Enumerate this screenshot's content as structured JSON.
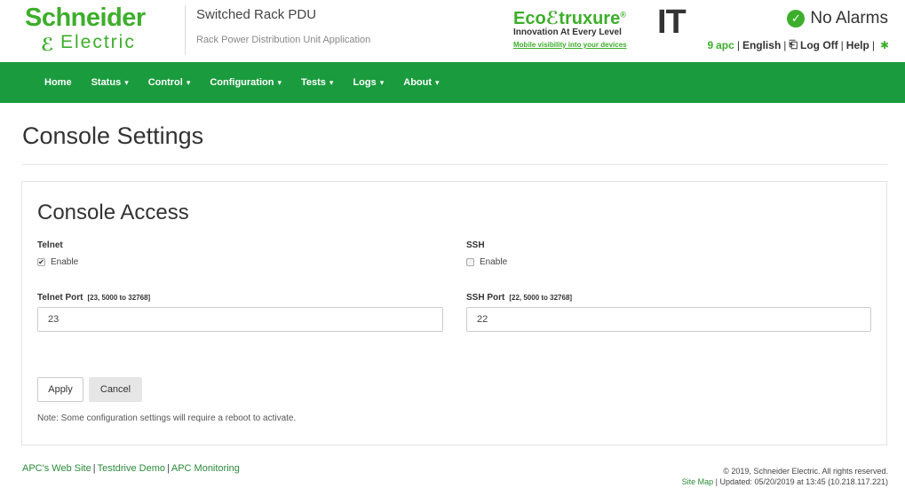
{
  "header": {
    "logo_top": "Schneider",
    "logo_bottom": "Electric",
    "app_name": "Switched Rack PDU",
    "app_sub": "Rack Power Distribution Unit Application",
    "eco_brand_left": "Eco",
    "eco_brand_right": "truxure",
    "eco_tag": "Innovation At Every Level",
    "eco_link": "Mobile visibility into your devices",
    "it_mark": "IT",
    "alarm_status": "No Alarms",
    "user": "apc",
    "language": "English",
    "logoff": "Log Off",
    "help": "Help"
  },
  "nav": {
    "items": [
      {
        "label": "Home",
        "caret": ""
      },
      {
        "label": "Status",
        "caret": "▾"
      },
      {
        "label": "Control",
        "caret": "▾"
      },
      {
        "label": "Configuration",
        "caret": "▾"
      },
      {
        "label": "Tests",
        "caret": "▾"
      },
      {
        "label": "Logs",
        "caret": "▾"
      },
      {
        "label": "About",
        "caret": "▾"
      }
    ]
  },
  "page": {
    "title": "Console Settings"
  },
  "console_access": {
    "section_title": "Console Access",
    "telnet": {
      "label": "Telnet",
      "enable_label": "Enable",
      "enabled": true,
      "port_label": "Telnet Port",
      "port_hint": "[23, 5000 to 32768]",
      "port_value": "23"
    },
    "ssh": {
      "label": "SSH",
      "enable_label": "Enable",
      "enabled": false,
      "port_label": "SSH Port",
      "port_hint": "[22, 5000 to 32768]",
      "port_value": "22"
    },
    "apply_label": "Apply",
    "cancel_label": "Cancel",
    "note": "Note: Some configuration settings will require a reboot to activate."
  },
  "footer": {
    "links": [
      "APC's Web Site",
      "Testdrive Demo",
      "APC Monitoring"
    ],
    "copyright": "© 2019, Schneider Electric. All rights reserved.",
    "site_map": "Site Map",
    "updated": "Updated: 05/20/2019 at 13:45 (10.218.117.221)"
  },
  "colors": {
    "brand_green": "#3dae2b",
    "nav_green": "#1a9b3e",
    "link_green": "#2a8a3a"
  }
}
